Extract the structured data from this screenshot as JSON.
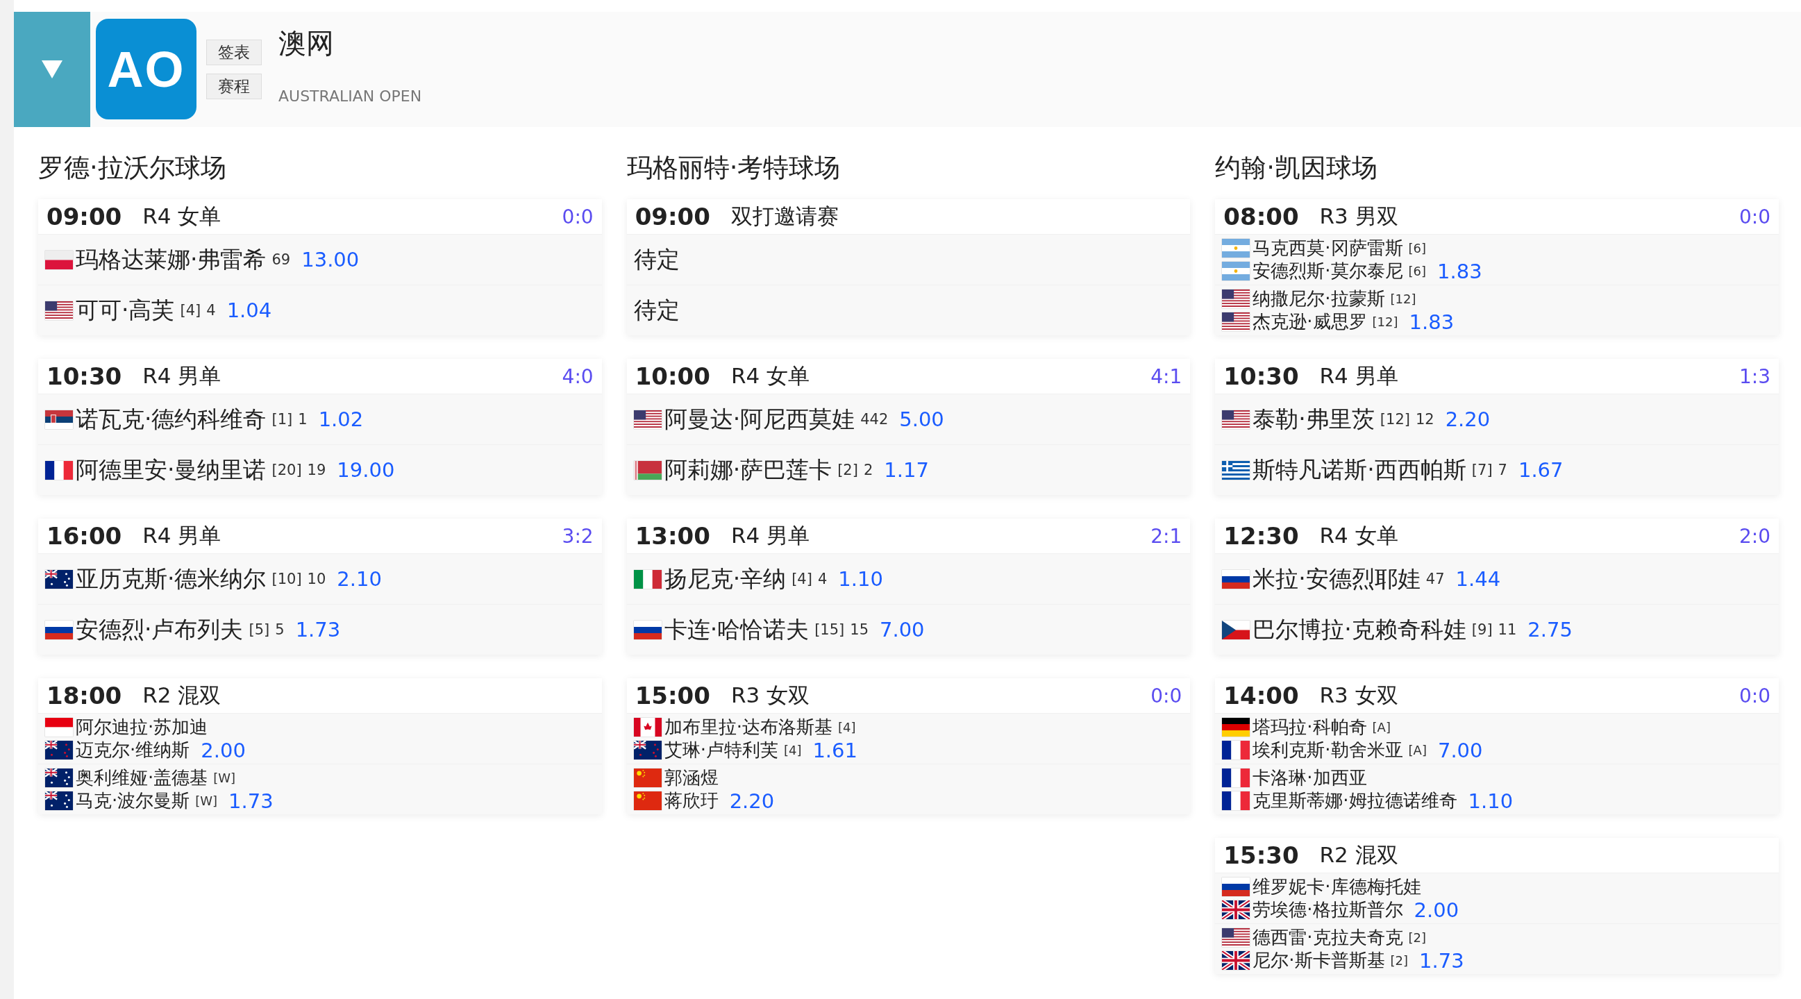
{
  "header": {
    "logo": "AO",
    "buttons": [
      "签表",
      "赛程"
    ],
    "title": "澳网",
    "subtitle": "AUSTRALIAN OPEN"
  },
  "courts": [
    {
      "name": "罗德·拉沃尔球场",
      "matches": [
        {
          "time": "09:00",
          "round": "R4 女单",
          "score": "0:0",
          "kind": "singles",
          "sides": [
            {
              "flag": {
                "kind": "pl"
              },
              "name": "玛格达莱娜·弗雷希",
              "rank": "69",
              "odds": "13.00"
            },
            {
              "flag": {
                "kind": "us"
              },
              "name": "可可·高芙",
              "seed": "[4]",
              "rank": "4",
              "odds": "1.04"
            }
          ]
        },
        {
          "time": "10:30",
          "round": "R4 男单",
          "score": "4:0",
          "kind": "singles",
          "sides": [
            {
              "flag": {
                "kind": "rs"
              },
              "name": "诺瓦克·德约科维奇",
              "seed": "[1]",
              "rank": "1",
              "odds": "1.02"
            },
            {
              "flag": {
                "kind": "fr"
              },
              "name": "阿德里安·曼纳里诺",
              "seed": "[20]",
              "rank": "19",
              "odds": "19.00"
            }
          ]
        },
        {
          "time": "16:00",
          "round": "R4 男单",
          "score": "3:2",
          "kind": "singles",
          "sides": [
            {
              "flag": {
                "kind": "au"
              },
              "name": "亚历克斯·德米纳尔",
              "seed": "[10]",
              "rank": "10",
              "odds": "2.10"
            },
            {
              "flag": {
                "kind": "ru"
              },
              "name": "安德烈·卢布列夫",
              "seed": "[5]",
              "rank": "5",
              "odds": "1.73"
            }
          ]
        },
        {
          "time": "18:00",
          "round": "R2 混双",
          "kind": "doubles",
          "sides": [
            {
              "players": [
                {
                  "flag": {
                    "kind": "id"
                  },
                  "name": "阿尔迪拉·苏加迪"
                },
                {
                  "flag": {
                    "kind": "nz"
                  },
                  "name": "迈克尔·维纳斯"
                }
              ],
              "odds": "2.00"
            },
            {
              "players": [
                {
                  "flag": {
                    "kind": "au"
                  },
                  "name": "奥利维娅·盖德基",
                  "seed": "[W]"
                },
                {
                  "flag": {
                    "kind": "au"
                  },
                  "name": "马克·波尔曼斯",
                  "seed": "[W]"
                }
              ],
              "odds": "1.73"
            }
          ]
        }
      ]
    },
    {
      "name": "玛格丽特·考特球场",
      "matches": [
        {
          "time": "09:00",
          "round": "双打邀请赛",
          "kind": "singles",
          "sides": [
            {
              "name": "待定"
            },
            {
              "name": "待定"
            }
          ]
        },
        {
          "time": "10:00",
          "round": "R4 女单",
          "score": "4:1",
          "kind": "singles",
          "sides": [
            {
              "flag": {
                "kind": "us"
              },
              "name": "阿曼达·阿尼西莫娃",
              "rank": "442",
              "odds": "5.00"
            },
            {
              "flag": {
                "kind": "by"
              },
              "name": "阿莉娜·萨巴莲卡",
              "seed": "[2]",
              "rank": "2",
              "odds": "1.17"
            }
          ]
        },
        {
          "time": "13:00",
          "round": "R4 男单",
          "score": "2:1",
          "kind": "singles",
          "sides": [
            {
              "flag": {
                "kind": "it"
              },
              "name": "扬尼克·辛纳",
              "seed": "[4]",
              "rank": "4",
              "odds": "1.10"
            },
            {
              "flag": {
                "kind": "ru"
              },
              "name": "卡连·哈恰诺夫",
              "seed": "[15]",
              "rank": "15",
              "odds": "7.00"
            }
          ]
        },
        {
          "time": "15:00",
          "round": "R3 女双",
          "score": "0:0",
          "kind": "doubles",
          "sides": [
            {
              "players": [
                {
                  "flag": {
                    "kind": "ca"
                  },
                  "name": "加布里拉·达布洛斯基",
                  "seed": "[4]"
                },
                {
                  "flag": {
                    "kind": "nz"
                  },
                  "name": "艾琳·卢特利芙",
                  "seed": "[4]"
                }
              ],
              "odds": "1.61"
            },
            {
              "players": [
                {
                  "flag": {
                    "kind": "cn"
                  },
                  "name": "郭涵煜"
                },
                {
                  "flag": {
                    "kind": "cn"
                  },
                  "name": "蒋欣玗"
                }
              ],
              "odds": "2.20"
            }
          ]
        }
      ]
    },
    {
      "name": "约翰·凯因球场",
      "matches": [
        {
          "time": "08:00",
          "round": "R3 男双",
          "score": "0:0",
          "kind": "doubles",
          "sides": [
            {
              "players": [
                {
                  "flag": {
                    "kind": "ar"
                  },
                  "name": "马克西莫·冈萨雷斯",
                  "seed": "[6]"
                },
                {
                  "flag": {
                    "kind": "ar"
                  },
                  "name": "安德烈斯·莫尔泰尼",
                  "seed": "[6]"
                }
              ],
              "odds": "1.83"
            },
            {
              "players": [
                {
                  "flag": {
                    "kind": "us"
                  },
                  "name": "纳撒尼尔·拉蒙斯",
                  "seed": "[12]"
                },
                {
                  "flag": {
                    "kind": "us"
                  },
                  "name": "杰克逊·威思罗",
                  "seed": "[12]"
                }
              ],
              "odds": "1.83"
            }
          ]
        },
        {
          "time": "10:30",
          "round": "R4 男单",
          "score": "1:3",
          "kind": "singles",
          "sides": [
            {
              "flag": {
                "kind": "us"
              },
              "name": "泰勒·弗里茨",
              "seed": "[12]",
              "rank": "12",
              "odds": "2.20"
            },
            {
              "flag": {
                "kind": "gr"
              },
              "name": "斯特凡诺斯·西西帕斯",
              "seed": "[7]",
              "rank": "7",
              "odds": "1.67"
            }
          ]
        },
        {
          "time": "12:30",
          "round": "R4 女单",
          "score": "2:0",
          "kind": "singles",
          "sides": [
            {
              "flag": {
                "kind": "ru"
              },
              "name": "米拉·安德烈耶娃",
              "rank": "47",
              "odds": "1.44"
            },
            {
              "flag": {
                "kind": "cz"
              },
              "name": "巴尔博拉·克赖奇科娃",
              "seed": "[9]",
              "rank": "11",
              "odds": "2.75"
            }
          ]
        },
        {
          "time": "14:00",
          "round": "R3 女双",
          "score": "0:0",
          "kind": "doubles",
          "sides": [
            {
              "players": [
                {
                  "flag": {
                    "kind": "de"
                  },
                  "name": "塔玛拉·科帕奇",
                  "seed": "[A]"
                },
                {
                  "flag": {
                    "kind": "fr"
                  },
                  "name": "埃利克斯·勒舍米亚",
                  "seed": "[A]"
                }
              ],
              "odds": "7.00"
            },
            {
              "players": [
                {
                  "flag": {
                    "kind": "fr"
                  },
                  "name": "卡洛琳·加西亚"
                },
                {
                  "flag": {
                    "kind": "fr"
                  },
                  "name": "克里斯蒂娜·姆拉德诺维奇"
                }
              ],
              "odds": "1.10"
            }
          ]
        },
        {
          "time": "15:30",
          "round": "R2 混双",
          "kind": "doubles",
          "sides": [
            {
              "players": [
                {
                  "flag": {
                    "kind": "ru"
                  },
                  "name": "维罗妮卡·库德梅托娃"
                },
                {
                  "flag": {
                    "kind": "gb"
                  },
                  "name": "劳埃德·格拉斯普尔"
                }
              ],
              "odds": "2.00"
            },
            {
              "players": [
                {
                  "flag": {
                    "kind": "us"
                  },
                  "name": "德西雷·克拉夫奇克",
                  "seed": "[2]"
                },
                {
                  "flag": {
                    "kind": "gb"
                  },
                  "name": "尼尔·斯卡普斯基",
                  "seed": "[2]"
                }
              ],
              "odds": "1.73"
            }
          ]
        }
      ]
    }
  ]
}
